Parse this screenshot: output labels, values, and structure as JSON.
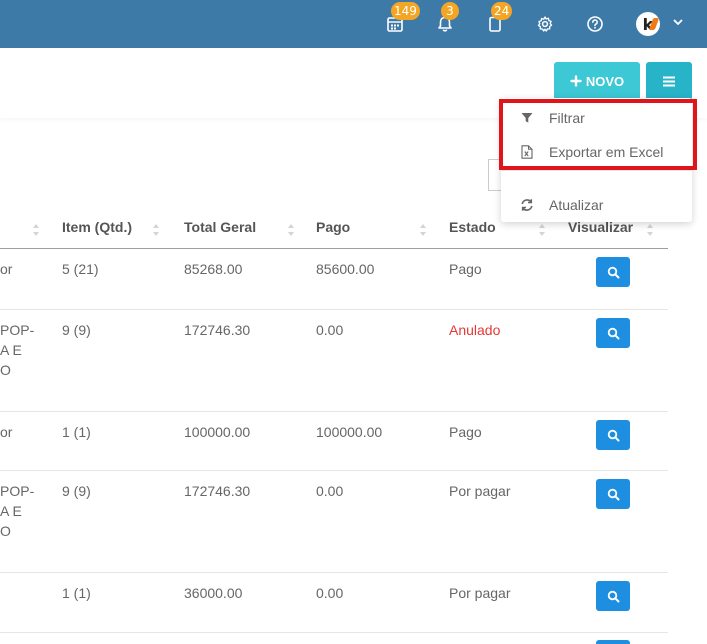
{
  "topbar": {
    "badges": {
      "calendar": "149",
      "notifications": "3",
      "documents": "24"
    },
    "icons": [
      "calendar-icon",
      "bell-icon",
      "document-icon",
      "gear-icon",
      "help-icon",
      "avatar",
      "chevron-down-icon"
    ]
  },
  "header": {
    "novo_label": "NOVO",
    "menu_icon": "hamburger-icon"
  },
  "dropdown": {
    "items": [
      {
        "label": "Filtrar",
        "icon": "filter-icon"
      },
      {
        "label": "Exportar em Excel",
        "icon": "excel-file-icon"
      },
      {
        "label": "Atualizar",
        "icon": "refresh-icon"
      }
    ]
  },
  "table": {
    "columns": [
      "Item (Qtd.)",
      "Total Geral",
      "Pago",
      "Estado",
      "Visualizar"
    ],
    "rows": [
      {
        "fragment": [
          "or"
        ],
        "item_qtd": "5 (21)",
        "total": "85268.00",
        "pago": "85600.00",
        "estado": "Pago",
        "estado_color": "#666666"
      },
      {
        "fragment": [
          "POP-",
          "A E",
          "O"
        ],
        "item_qtd": "9 (9)",
        "total": "172746.30",
        "pago": "0.00",
        "estado": "Anulado",
        "estado_color": "#e53935"
      },
      {
        "fragment": [
          "or"
        ],
        "item_qtd": "1 (1)",
        "total": "100000.00",
        "pago": "100000.00",
        "estado": "Pago",
        "estado_color": "#666666"
      },
      {
        "fragment": [
          "POP-",
          "A E",
          "O"
        ],
        "item_qtd": "9 (9)",
        "total": "172746.30",
        "pago": "0.00",
        "estado": "Por pagar",
        "estado_color": "#666666"
      },
      {
        "fragment": [
          ""
        ],
        "item_qtd": "1 (1)",
        "total": "36000.00",
        "pago": "0.00",
        "estado": "Por pagar",
        "estado_color": "#666666"
      }
    ]
  },
  "colors": {
    "topbar": "#3e7aa8",
    "badge": "#f5a524",
    "novo_button": "#3cc8d4",
    "menu_button": "#27b4c8",
    "view_button": "#1e8fe0",
    "annulled": "#e53935",
    "highlight": "#e0151b"
  }
}
